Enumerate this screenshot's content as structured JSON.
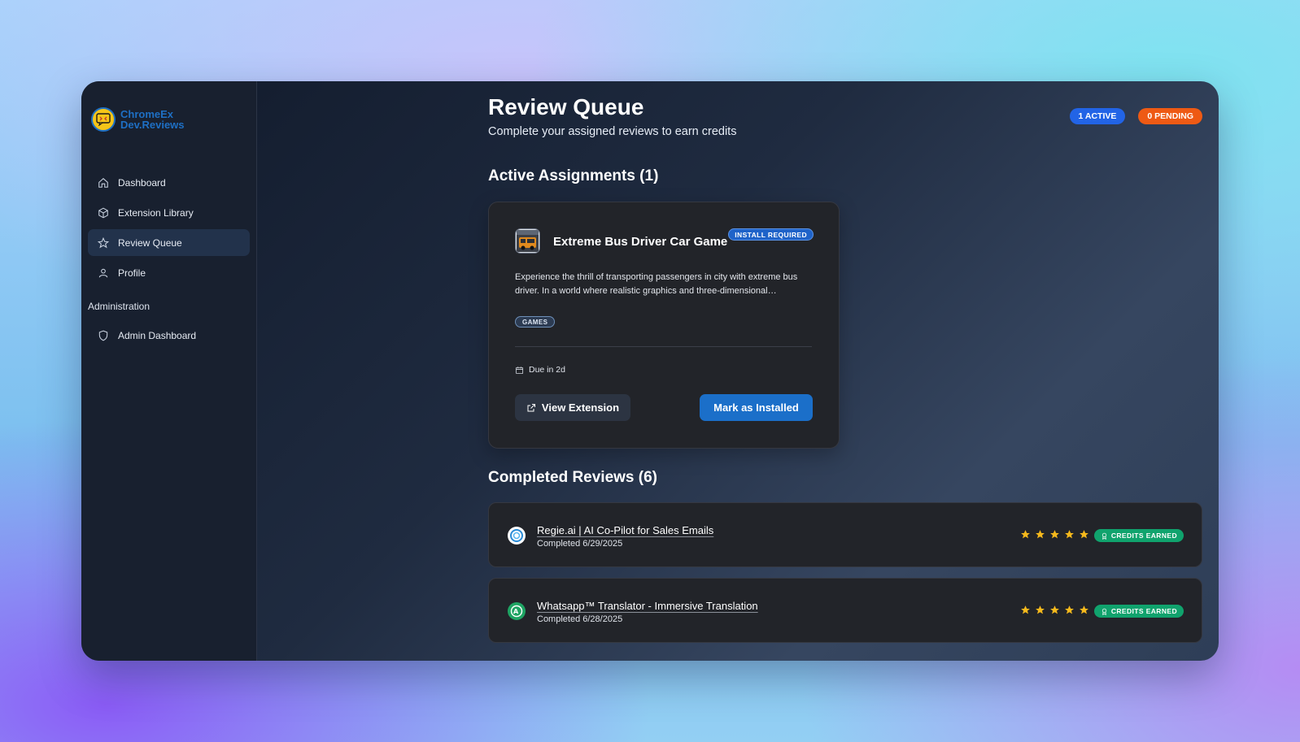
{
  "brand": {
    "line1": "ChromeEx",
    "line2": "Dev.Reviews"
  },
  "nav": {
    "items": [
      {
        "label": "Dashboard",
        "icon": "home-icon"
      },
      {
        "label": "Extension Library",
        "icon": "box-icon"
      },
      {
        "label": "Review Queue",
        "icon": "star-icon",
        "active": true
      },
      {
        "label": "Profile",
        "icon": "user-icon"
      }
    ],
    "admin_section": "Administration",
    "admin_items": [
      {
        "label": "Admin Dashboard",
        "icon": "shield-icon"
      }
    ]
  },
  "header": {
    "title": "Review Queue",
    "subtitle": "Complete your assigned reviews to earn credits",
    "active_badge": "1 ACTIVE",
    "pending_badge": "0 PENDING"
  },
  "active_section": {
    "title": "Active Assignments (1)",
    "card": {
      "title": "Extreme Bus Driver Car Game",
      "status": "INSTALL REQUIRED",
      "description": "Experience the thrill of transporting passengers in city with extreme bus driver. In a world where realistic graphics and three-dimensional…",
      "tag": "GAMES",
      "due": "Due in 2d",
      "view_label": "View Extension",
      "install_label": "Mark as Installed"
    }
  },
  "completed_section": {
    "title": "Completed Reviews (6)",
    "reviews": [
      {
        "name": "Regie.ai | AI Co-Pilot for Sales Emails",
        "date": "Completed 6/29/2025",
        "rating": 5,
        "badge": "CREDITS EARNED",
        "icon": "regie-logo-icon"
      },
      {
        "name": "Whatsapp™ Translator - Immersive Translation",
        "date": "Completed 6/28/2025",
        "rating": 5,
        "badge": "CREDITS EARNED",
        "icon": "translator-logo-icon"
      }
    ]
  },
  "colors": {
    "accent": "#1b6fc9",
    "active_badge": "#2264e6",
    "pending_badge": "#ee5a14",
    "credits": "#10a36d",
    "star": "#f6b91c"
  }
}
